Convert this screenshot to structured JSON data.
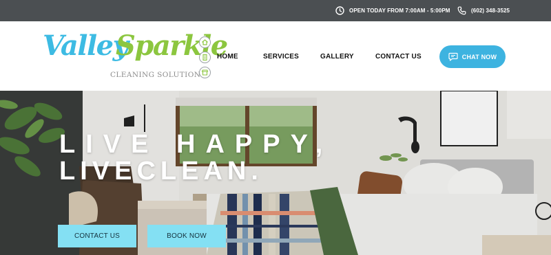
{
  "topbar": {
    "hours_text": "OPEN TODAY FROM 7:00AM - 5:00PM",
    "phone_text": "(602) 348-3525",
    "clock_icon": "clock-icon",
    "phone_icon": "phone-icon"
  },
  "logo": {
    "word1": "Valley",
    "word2": "Sparkle",
    "tagline": "CLEANING SOLUTIONS",
    "emblems": [
      "house-icon",
      "building-icon",
      "store-icon"
    ]
  },
  "nav": {
    "items": [
      "HOME",
      "SERVICES",
      "GALLERY",
      "CONTACT US"
    ]
  },
  "chat_button": {
    "label": "CHAT NOW",
    "icon": "chat-bubble-icon"
  },
  "hero": {
    "headline_line1": "LIVE HAPPY,",
    "headline_line2": "LIVECLEAN.",
    "cta_contact": "CONTACT US",
    "cta_book": "BOOK NOW"
  },
  "colors": {
    "topbar_bg": "#4b4f52",
    "brand_blue": "#3dbbe3",
    "brand_green": "#8cc63f",
    "chat_button_bg": "#3db3e0",
    "cta_bg": "#84e0f3"
  }
}
